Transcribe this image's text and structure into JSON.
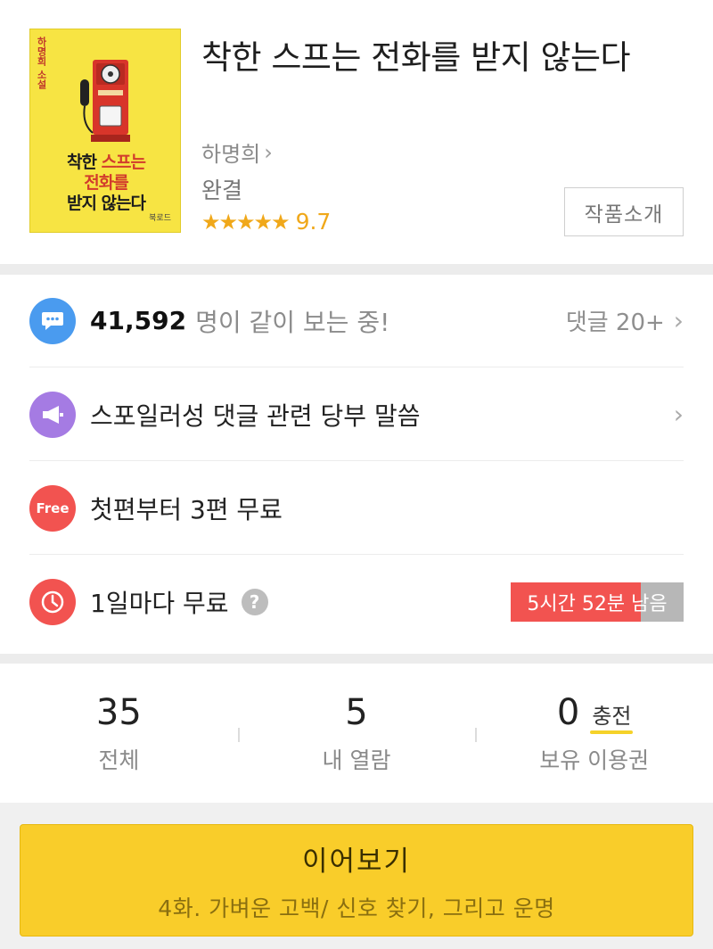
{
  "book": {
    "title": "착한 스프는 전화를 받지 않는다",
    "author": "하명희",
    "status": "완결",
    "stars": "★★★★★",
    "score": "9.7",
    "intro_button": "작품소개",
    "cover": {
      "author_label": "하명희 소설",
      "title_line1_a": "착한 ",
      "title_line1_b": "스프는",
      "title_line2": "전화를",
      "title_line3": "받지 않는다",
      "publisher": "북로드"
    }
  },
  "rows": {
    "viewers": {
      "count": "41,592",
      "text": "명이 같이 보는 중!",
      "comments": "댓글 20+",
      "icon": "chat-bubble-icon",
      "color": "#4a9bef"
    },
    "notice": {
      "text": "스포일러성 댓글 관련 당부 말씀",
      "icon": "megaphone-icon",
      "color": "#a57be3"
    },
    "free": {
      "badge": "Free",
      "text": "첫편부터 3편 무료",
      "color": "#f25350"
    },
    "daily": {
      "text": "1일마다 무료",
      "help": "?",
      "timer": "5시간 52분 남음",
      "timer_progress": 0.75,
      "icon": "clock-icon",
      "color": "#f25350"
    }
  },
  "stats": {
    "total": {
      "value": "35",
      "label": "전체"
    },
    "viewed": {
      "value": "5",
      "label": "내 열람"
    },
    "tickets": {
      "value": "0",
      "label": "보유 이용권",
      "charge": "충전"
    }
  },
  "continue": {
    "label": "이어보기",
    "subtitle": "4화. 가벼운 고백/ 신호 찾기, 그리고 운명"
  },
  "colors": {
    "accent_yellow": "#f9cd2a",
    "star_orange": "#f0a81a",
    "red": "#f25350"
  }
}
